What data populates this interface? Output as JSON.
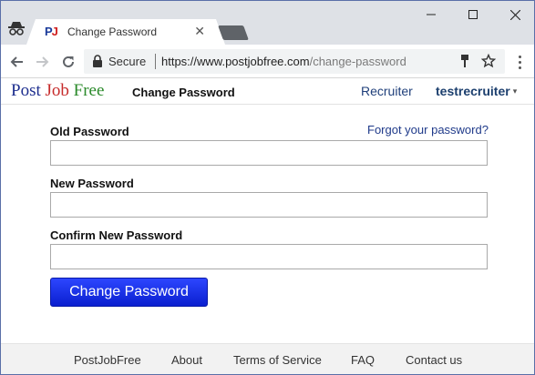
{
  "browser": {
    "tab_title": "Change Password",
    "tab_favicon": "PJ",
    "secure_label": "Secure",
    "url_host": "https://www.postjobfree.com",
    "url_path": "/change-password"
  },
  "site": {
    "logo": {
      "post": "Post",
      "job": "Job",
      "free": "Free"
    },
    "page_title": "Change Password",
    "nav": {
      "recruiter": "Recruiter",
      "username": "testrecruiter",
      "caret": "▾"
    }
  },
  "form": {
    "old_password_label": "Old Password",
    "forgot_link": "Forgot your password?",
    "new_password_label": "New Password",
    "confirm_password_label": "Confirm New Password",
    "old_password_value": "",
    "new_password_value": "",
    "confirm_password_value": "",
    "submit_label": "Change Password"
  },
  "footer": {
    "links": [
      "PostJobFree",
      "About",
      "Terms of Service",
      "FAQ",
      "Contact us"
    ]
  },
  "icons": {
    "incognito": "incognito-icon",
    "back": "back-arrow-icon",
    "forward": "forward-arrow-icon",
    "reload": "reload-icon",
    "lock": "lock-icon",
    "brush": "paint-brush-icon",
    "star": "star-icon",
    "menu": "kebab-menu-icon"
  }
}
